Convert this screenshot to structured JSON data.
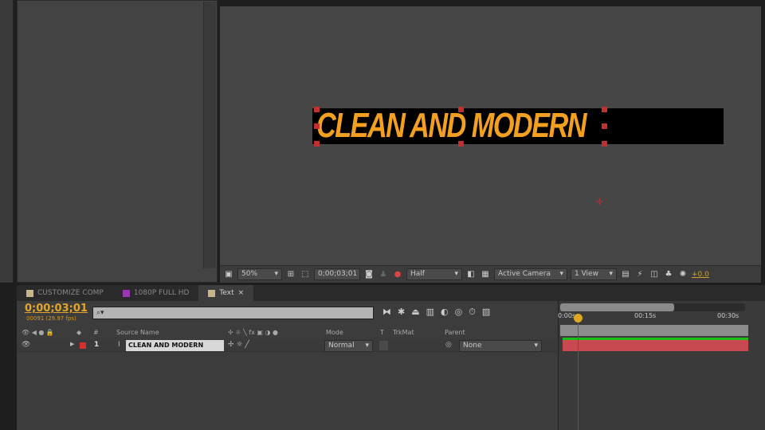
{
  "viewer": {
    "comp_text": "CLEAN AND MODERN",
    "zoom": "50%",
    "timecode": "0;00;03;01",
    "resolution": "Half",
    "camera": "Active Camera",
    "views": "1 View",
    "exposure": "+0.0"
  },
  "timeline": {
    "tabs": [
      {
        "label": "CUSTOMIZE COMP",
        "color": "#c8b68a"
      },
      {
        "label": "1080P FULL HD",
        "color": "#9b35b0"
      },
      {
        "label": "Text",
        "color": "#c8b68a",
        "close": "×"
      }
    ],
    "current_time": "0;00;03;01",
    "frame_info": "00091 (29.97 fps)",
    "search_placeholder": "⌕▾",
    "columns": {
      "num": "#",
      "source_name": "Source Name",
      "mode": "Mode",
      "t": "T",
      "trkmat": "TrkMat",
      "parent": "Parent"
    },
    "layers": [
      {
        "index": "1",
        "name": "CLEAN AND MODERN",
        "mode": "Normal",
        "parent": "None",
        "label_color": "#d03030"
      }
    ],
    "ruler": [
      "0:00s",
      "00:15s",
      "00:30s"
    ],
    "accent": "#e3a52a"
  }
}
